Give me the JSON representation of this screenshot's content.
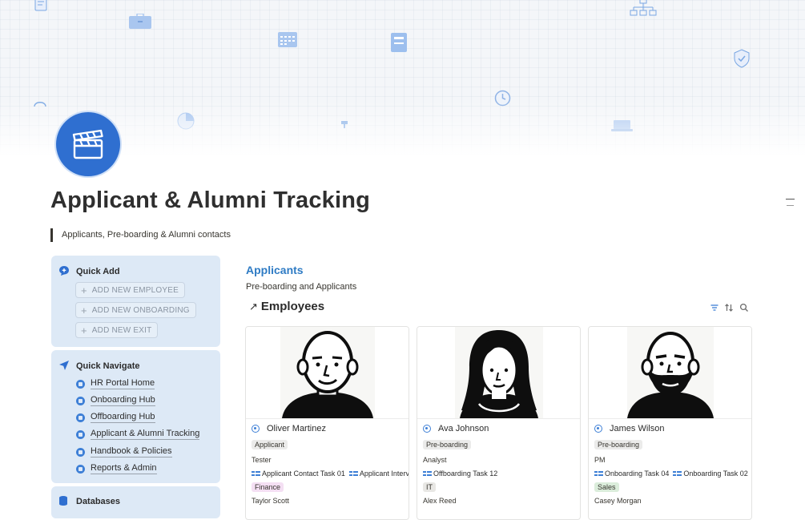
{
  "page": {
    "title": "Applicant & Alumni Tracking",
    "quote": "Applicants, Pre-boarding & Alumni contacts",
    "icon": "clapperboard-icon"
  },
  "sidebar": {
    "quick_add": {
      "title": "Quick Add",
      "icon": "chat-plus-icon",
      "buttons": [
        "ADD NEW EMPLOYEE",
        "ADD NEW ONBOARDING",
        "ADD NEW EXIT"
      ]
    },
    "quick_navigate": {
      "title": "Quick Navigate",
      "icon": "navigation-arrow-icon",
      "items": [
        "HR Portal Home",
        "Onboarding Hub",
        "Offboarding Hub",
        "Applicant & Alumni Tracking",
        "Handbook & Policies",
        "Reports & Admin"
      ]
    },
    "databases": {
      "title": "Databases",
      "icon": "database-icon"
    }
  },
  "main": {
    "section_link": "Applicants",
    "section_sub": "Pre-boarding and Applicants",
    "db_title": "Employees",
    "db_arrow": "↗",
    "toolbar_icons": [
      "filter-icon",
      "sort-icon",
      "search-icon"
    ],
    "cards": [
      {
        "name": "Oliver Martinez",
        "status": "Applicant",
        "role": "Tester",
        "tasks": [
          "Applicant Contact Task 01",
          "Applicant Intervie"
        ],
        "department": "Finance",
        "person": "Taylor Scott"
      },
      {
        "name": "Ava Johnson",
        "status": "Pre-boarding",
        "role": "Analyst",
        "tasks": [
          "Offboarding Task 12"
        ],
        "department": "IT",
        "person": "Alex Reed"
      },
      {
        "name": "James Wilson",
        "status": "Pre-boarding",
        "role": "PM",
        "tasks": [
          "Onboarding Task 04",
          "Onboarding Task 02"
        ],
        "department": "Sales",
        "person": "Casey Morgan"
      }
    ]
  },
  "colors": {
    "accent": "#2e7bc4",
    "icon_blue": "#2f6fd0",
    "panel_bg": "#dde9f6",
    "status_tag_bg": "#ebebea",
    "finance_tag_bg": "#f4dff3",
    "it_tag_bg": "#e8e7e4",
    "sales_tag_bg": "#dbeddb"
  }
}
